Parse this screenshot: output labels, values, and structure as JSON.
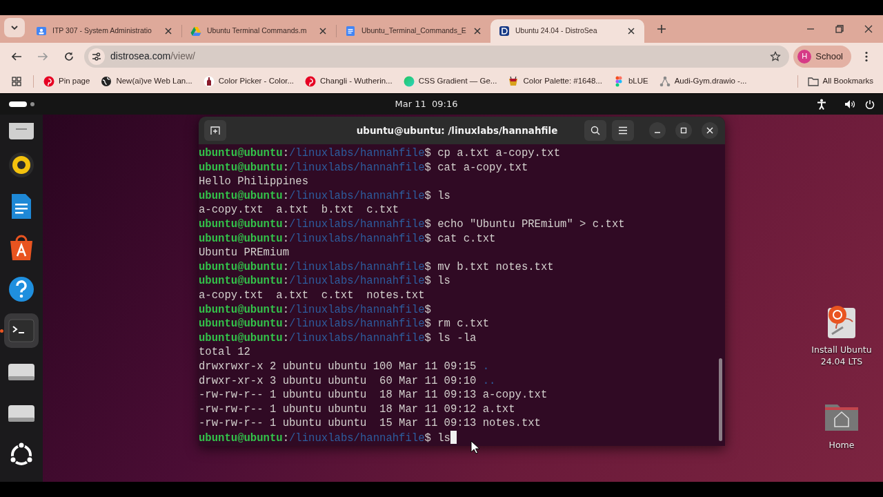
{
  "browser": {
    "tabs": [
      {
        "title": "ITP 307 - System Administratio",
        "kind": "classroom",
        "selected": false
      },
      {
        "title": "Ubuntu Terminal Commands.m",
        "kind": "drive",
        "selected": false
      },
      {
        "title": "Ubuntu_Terminal_Commands_E",
        "kind": "docs",
        "selected": false
      },
      {
        "title": "Ubuntu 24.04 - DistroSea",
        "kind": "distrosea",
        "selected": true
      }
    ],
    "address": {
      "host": "distrosea.com",
      "path": "/view/"
    },
    "profile": {
      "initial": "H",
      "name": "School"
    },
    "bookmarks": [
      {
        "label": "Pin page",
        "kind": "pinterest"
      },
      {
        "label": "New(ai)ve Web Lan...",
        "kind": "globe"
      },
      {
        "label": "Color Picker - Color...",
        "kind": "bottle"
      },
      {
        "label": "Changli - Wutherin...",
        "kind": "pinterest"
      },
      {
        "label": "CSS Gradient — Ge...",
        "kind": "gradient"
      },
      {
        "label": "Color Palette: #1648...",
        "kind": "cup"
      },
      {
        "label": "bLUE",
        "kind": "figma"
      },
      {
        "label": "Audi-Gym.drawio -...",
        "kind": "nodes"
      }
    ],
    "all_bookmarks": "All Bookmarks"
  },
  "desktop": {
    "clock": "Mar 11  09:16",
    "dock": [
      {
        "kind": "files",
        "active": false
      },
      {
        "kind": "rhythmbox",
        "active": false
      },
      {
        "kind": "writer",
        "active": false
      },
      {
        "kind": "appcenter",
        "active": false
      },
      {
        "kind": "help",
        "active": false
      },
      {
        "kind": "terminal",
        "active": true
      },
      {
        "kind": "drive",
        "active": false
      },
      {
        "kind": "drive",
        "active": false
      },
      {
        "kind": "apps",
        "active": false
      }
    ],
    "icons": [
      {
        "label": "Install Ubuntu 24.04 LTS",
        "kind": "installer"
      },
      {
        "label": "Home",
        "kind": "home"
      }
    ],
    "terminal": {
      "title": "ubuntu@ubuntu: /linuxlabs/hannahfile",
      "lines": [
        {
          "kind": "prompt",
          "user": "ubuntu@ubuntu",
          "separator": ":",
          "path": "/linuxlabs/hannahfile",
          "symbol": "$",
          "command": "cp a.txt a-copy.txt"
        },
        {
          "kind": "prompt",
          "user": "ubuntu@ubuntu",
          "separator": ":",
          "path": "/linuxlabs/hannahfile",
          "symbol": "$",
          "command": "cat a-copy.txt"
        },
        {
          "kind": "output",
          "text": "Hello Philippines"
        },
        {
          "kind": "prompt",
          "user": "ubuntu@ubuntu",
          "separator": ":",
          "path": "/linuxlabs/hannahfile",
          "symbol": "$",
          "command": "ls"
        },
        {
          "kind": "output",
          "text": "a-copy.txt  a.txt  b.txt  c.txt"
        },
        {
          "kind": "prompt",
          "user": "ubuntu@ubuntu",
          "separator": ":",
          "path": "/linuxlabs/hannahfile",
          "symbol": "$",
          "command": "echo \"Ubuntu PREmium\" > c.txt"
        },
        {
          "kind": "prompt",
          "user": "ubuntu@ubuntu",
          "separator": ":",
          "path": "/linuxlabs/hannahfile",
          "symbol": "$",
          "command": "cat c.txt"
        },
        {
          "kind": "output",
          "text": "Ubuntu PREmium"
        },
        {
          "kind": "prompt",
          "user": "ubuntu@ubuntu",
          "separator": ":",
          "path": "/linuxlabs/hannahfile",
          "symbol": "$",
          "command": "mv b.txt notes.txt"
        },
        {
          "kind": "prompt",
          "user": "ubuntu@ubuntu",
          "separator": ":",
          "path": "/linuxlabs/hannahfile",
          "symbol": "$",
          "command": "ls"
        },
        {
          "kind": "output",
          "text": "a-copy.txt  a.txt  c.txt  notes.txt"
        },
        {
          "kind": "prompt",
          "user": "ubuntu@ubuntu",
          "separator": ":",
          "path": "/linuxlabs/hannahfile",
          "symbol": "$"
        },
        {
          "kind": "prompt",
          "user": "ubuntu@ubuntu",
          "separator": ":",
          "path": "/linuxlabs/hannahfile",
          "symbol": "$",
          "command": "rm c.txt"
        },
        {
          "kind": "prompt",
          "user": "ubuntu@ubuntu",
          "separator": ":",
          "path": "/linuxlabs/hannahfile",
          "symbol": "$",
          "command": "ls -la"
        },
        {
          "kind": "output",
          "text": "total 12"
        },
        {
          "kind": "listing",
          "text": "drwxrwxr-x 2 ubuntu ubuntu 100 Mar 11 09:15",
          "name": ".",
          "directory": true
        },
        {
          "kind": "listing",
          "text": "drwxr-xr-x 3 ubuntu ubuntu  60 Mar 11 09:10",
          "name": "..",
          "directory": true
        },
        {
          "kind": "listing",
          "text": "-rw-rw-r-- 1 ubuntu ubuntu  18 Mar 11 09:13",
          "name": "a-copy.txt",
          "directory": false
        },
        {
          "kind": "listing",
          "text": "-rw-rw-r-- 1 ubuntu ubuntu  18 Mar 11 09:12",
          "name": "a.txt",
          "directory": false
        },
        {
          "kind": "listing",
          "text": "-rw-rw-r-- 1 ubuntu ubuntu  15 Mar 11 09:13",
          "name": "notes.txt",
          "directory": false
        },
        {
          "kind": "prompt",
          "user": "ubuntu@ubuntu",
          "separator": ":",
          "path": "/linuxlabs/hannahfile",
          "symbol": "$",
          "command": "ls",
          "cursor": true
        }
      ]
    }
  }
}
